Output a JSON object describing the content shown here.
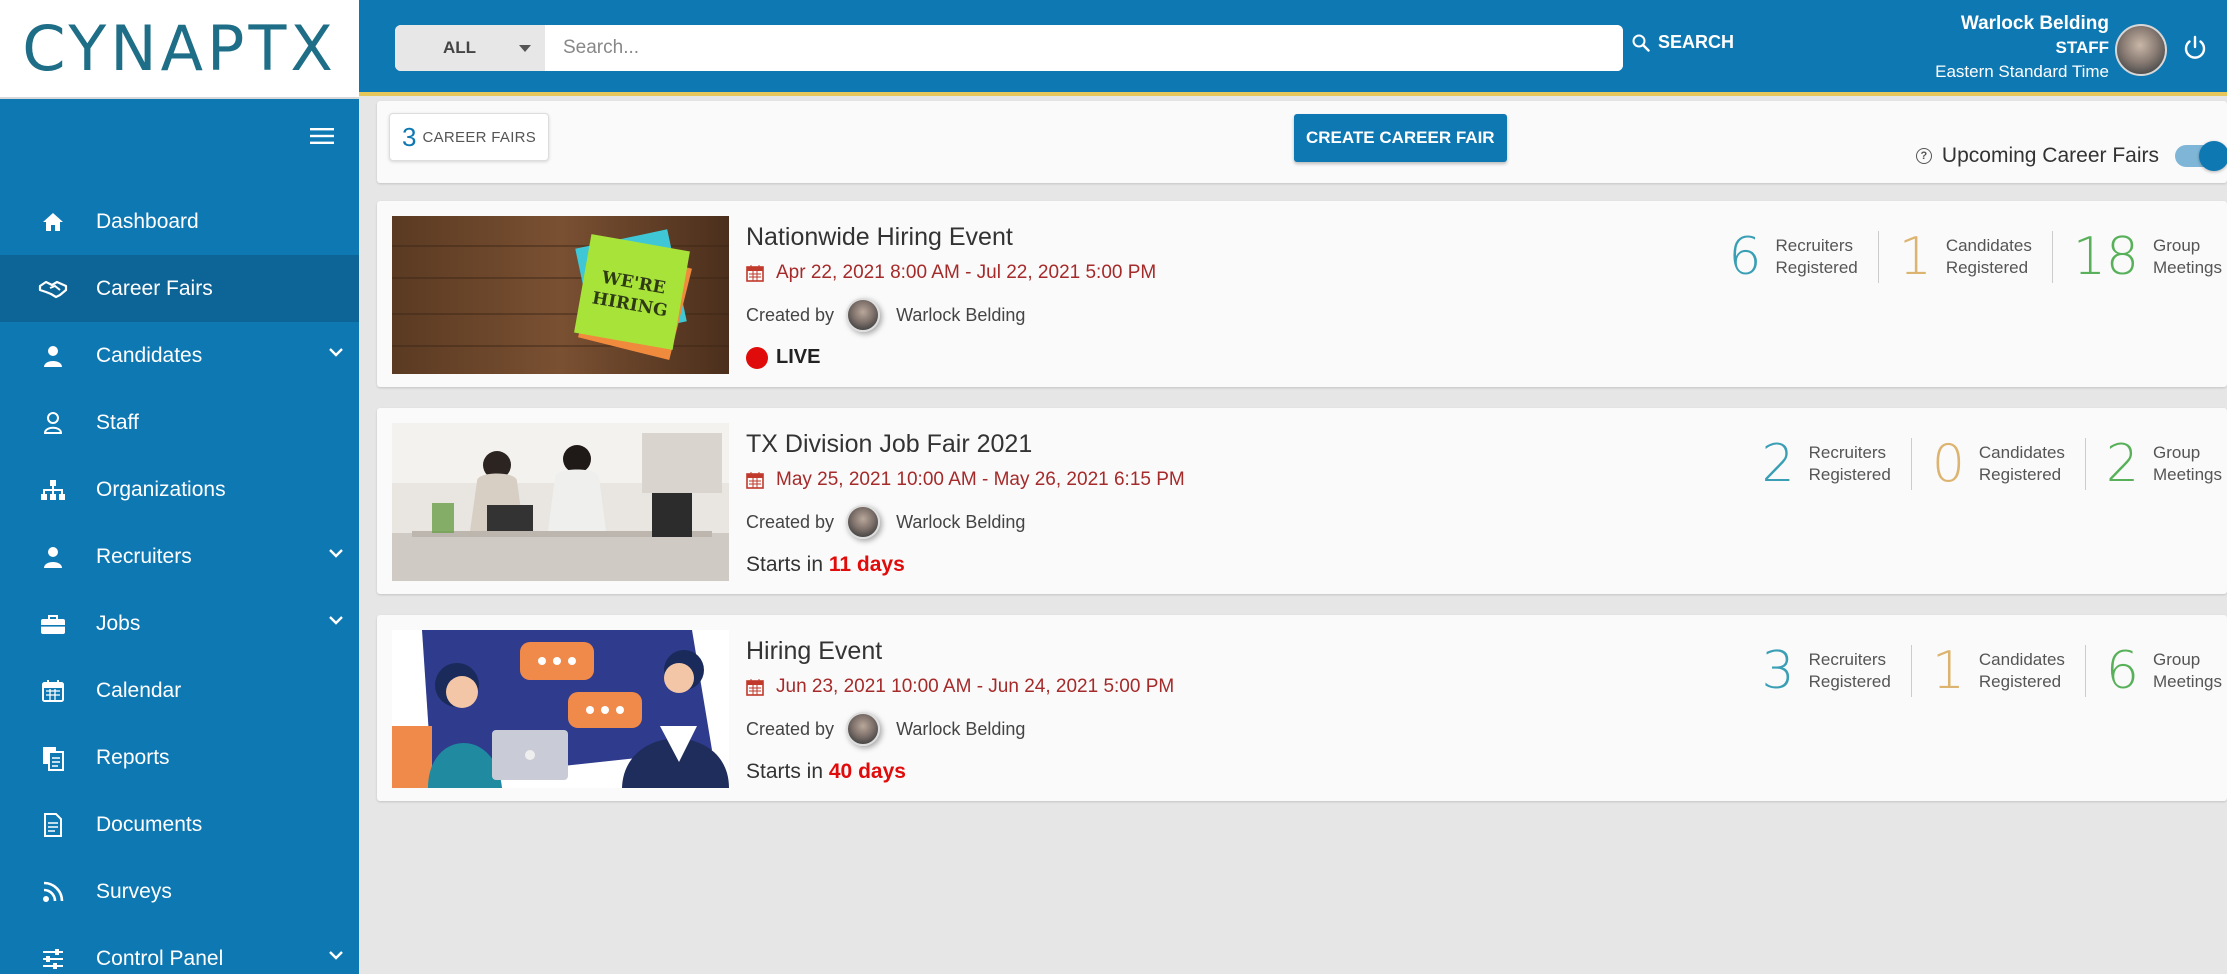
{
  "brand": {
    "logo_text": "CYNAPTX"
  },
  "search": {
    "filter_value": "ALL",
    "placeholder": "Search...",
    "button_label": "SEARCH"
  },
  "user": {
    "name": "Warlock Belding",
    "role": "STAFF",
    "timezone": "Eastern Standard Time"
  },
  "sidebar": {
    "items": [
      {
        "label": "Dashboard",
        "icon": "home-icon",
        "active": false,
        "has_submenu": false
      },
      {
        "label": "Career Fairs",
        "icon": "handshake-icon",
        "active": true,
        "has_submenu": false
      },
      {
        "label": "Candidates",
        "icon": "person-icon",
        "active": false,
        "has_submenu": true
      },
      {
        "label": "Staff",
        "icon": "user-outline-icon",
        "active": false,
        "has_submenu": false
      },
      {
        "label": "Organizations",
        "icon": "org-chart-icon",
        "active": false,
        "has_submenu": false
      },
      {
        "label": "Recruiters",
        "icon": "person-icon",
        "active": false,
        "has_submenu": true
      },
      {
        "label": "Jobs",
        "icon": "briefcase-icon",
        "active": false,
        "has_submenu": true
      },
      {
        "label": "Calendar",
        "icon": "calendar-icon",
        "active": false,
        "has_submenu": false
      },
      {
        "label": "Reports",
        "icon": "reports-icon",
        "active": false,
        "has_submenu": false
      },
      {
        "label": "Documents",
        "icon": "document-icon",
        "active": false,
        "has_submenu": false
      },
      {
        "label": "Surveys",
        "icon": "rss-icon",
        "active": false,
        "has_submenu": false
      },
      {
        "label": "Control Panel",
        "icon": "sliders-icon",
        "active": false,
        "has_submenu": true
      }
    ]
  },
  "toolbar": {
    "count": "3",
    "count_label": "CAREER FAIRS",
    "create_label": "CREATE CAREER FAIR",
    "upcoming_label": "Upcoming Career Fairs",
    "upcoming_on": true
  },
  "fairs": [
    {
      "title": "Nationwide Hiring Event",
      "dates": "Apr 22, 2021 8:00 AM - Jul 22, 2021 5:00 PM",
      "created_by_label": "Created by",
      "creator": "Warlock Belding",
      "status": "LIVE",
      "stats": {
        "recruiters": "6",
        "recruiters_l1": "Recruiters",
        "recruiters_l2": "Registered",
        "candidates": "1",
        "candidates_l1": "Candidates",
        "candidates_l2": "Registered",
        "groups": "18",
        "groups_l1": "Group",
        "groups_l2": "Meetings"
      }
    },
    {
      "title": "TX Division Job Fair 2021",
      "dates": "May 25, 2021 10:00 AM - May 26, 2021 6:15 PM",
      "created_by_label": "Created by",
      "creator": "Warlock Belding",
      "starts_label": "Starts in",
      "starts_days": "11 days",
      "stats": {
        "recruiters": "2",
        "recruiters_l1": "Recruiters",
        "recruiters_l2": "Registered",
        "candidates": "0",
        "candidates_l1": "Candidates",
        "candidates_l2": "Registered",
        "groups": "2",
        "groups_l1": "Group",
        "groups_l2": "Meetings"
      }
    },
    {
      "title": "Hiring Event",
      "dates": "Jun 23, 2021 10:00 AM - Jun 24, 2021 5:00 PM",
      "created_by_label": "Created by",
      "creator": "Warlock Belding",
      "starts_label": "Starts in",
      "starts_days": "40 days",
      "stats": {
        "recruiters": "3",
        "recruiters_l1": "Recruiters",
        "recruiters_l2": "Registered",
        "candidates": "1",
        "candidates_l1": "Candidates",
        "candidates_l2": "Registered",
        "groups": "6",
        "groups_l1": "Group",
        "groups_l2": "Meetings"
      }
    }
  ],
  "colors": {
    "primary": "#0e78b3",
    "active_nav": "#0c6497",
    "accent_bar": "#e7c75a",
    "date_text": "#a52a2a",
    "live_red": "#e00b0b",
    "recruiters": "#3a9fb5",
    "candidates": "#ddb46f",
    "groups": "#58b15a"
  }
}
